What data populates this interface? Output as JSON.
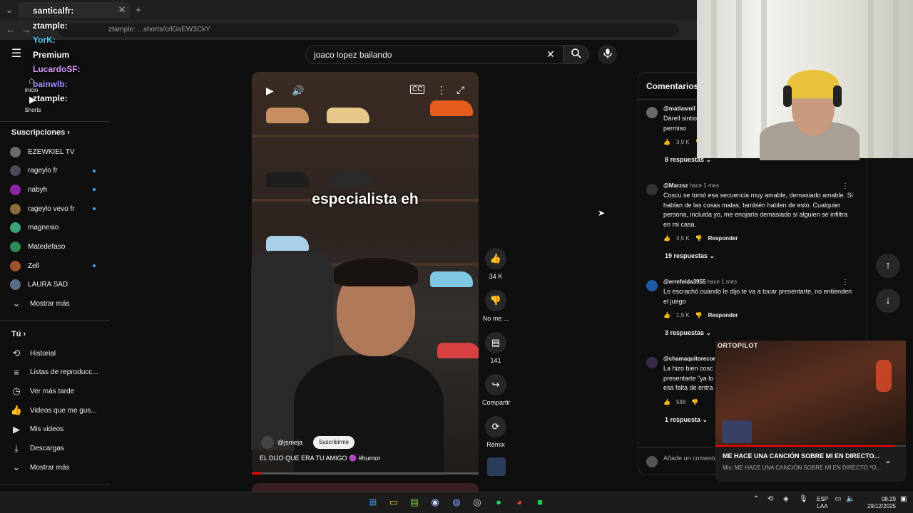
{
  "browser": {
    "tab_title": "santicalfr",
    "address": "ztample: ...shorts/crlGsEW3CkY"
  },
  "youtube": {
    "search_value": "joaco lopez bailando",
    "sidebar": {
      "main": [
        {
          "label": "Inicio",
          "icon": "home-icon"
        },
        {
          "label": "Shorts",
          "icon": "shorts-icon"
        }
      ],
      "subscriptions_title": "Suscripciones",
      "subscriptions": [
        {
          "label": "EZEWKIEL TV",
          "dot": false,
          "color": "#6b6b6b"
        },
        {
          "label": "rageylo fr",
          "dot": true,
          "color": "#4a4a5a"
        },
        {
          "label": "nabyh",
          "dot": true,
          "color": "#8e24aa"
        },
        {
          "label": "rageylo vevo fr",
          "dot": true,
          "color": "#8a6d3b"
        },
        {
          "label": "magnesio",
          "dot": false,
          "color": "#3aa57a"
        },
        {
          "label": "Matedefaso",
          "dot": false,
          "color": "#2e8b57"
        },
        {
          "label": "Zell",
          "dot": true,
          "color": "#a0522d"
        },
        {
          "label": "LAURA SAD",
          "dot": false,
          "color": "#5b6b8a"
        }
      ],
      "show_more": "Mostrar más",
      "you_title": "Tú",
      "you_items": [
        {
          "label": "Historial",
          "icon": "history-icon"
        },
        {
          "label": "Listas de reproducc...",
          "icon": "playlist-icon"
        },
        {
          "label": "Ver más tarde",
          "icon": "clock-icon"
        },
        {
          "label": "Videos que me gus...",
          "icon": "thumbs-up-icon"
        },
        {
          "label": "Mis videos",
          "icon": "my-videos-icon"
        },
        {
          "label": "Descargas",
          "icon": "download-icon"
        }
      ],
      "show_more_2": "Mostrar más"
    },
    "short": {
      "caption": "especialista eh",
      "channel": "@jsmeja",
      "subscribe": "Suscribirme",
      "title": "EL DIJO QUE ERA TU AMIGO 🟣 #humor",
      "progress": 0.04
    },
    "actions": {
      "like_count": "34 K",
      "dislike_label": "No me ...",
      "comments_count": "141",
      "share_label": "Compartir",
      "remix_label": "Remix"
    },
    "comments": {
      "title": "Comentarios",
      "items": [
        {
          "user": "@matiasmil",
          "time": "",
          "text": "Dárell sintio\npermiso",
          "likes": "3,9 K",
          "replies": "8 respuestas",
          "avatar": "#6a6a6a",
          "reply_label": ""
        },
        {
          "user": "@Marzsz",
          "time": "hace 1 mes",
          "text": "Coscu se tomó esa secuencia muy amable, demasiado amable. Si hablan de las cosas malas, también hablen de esto. Cualquier persona, incluida yo, me enojaría demasiado si alguien se infiltra en mi casa.",
          "likes": "4,5 K",
          "replies": "19 respuestas",
          "avatar": "#333333",
          "reply_label": "Responder"
        },
        {
          "user": "@errefelda3955",
          "time": "hace 1 mes",
          "text": "Lo escrachó cuando le dijo te va a tocar presentarte, no entienden el juego",
          "likes": "1,9 K",
          "replies": "3 respuestas",
          "avatar": "#1e5aa8",
          "reply_label": "Responder"
        },
        {
          "user": "@chamaquitorecor",
          "time": "",
          "text": "La hizo bien cosc\npresentarte \"ya lo\nesa falta de entra",
          "likes": "588",
          "replies": "1 respuesta",
          "avatar": "#3a2a4a",
          "reply_label": ""
        }
      ],
      "add_placeholder": "Añade un comentario"
    }
  },
  "stream_overlay": {
    "players": [
      {
        "name": "santicalfr:",
        "color": "#ffffff"
      },
      {
        "name": "ztample:",
        "color": "#ffffff"
      },
      {
        "name": "YorK:",
        "color": "#4dd2ff"
      },
      {
        "name": "Premium",
        "color": "#ffffff"
      },
      {
        "name": "LucardoSF:",
        "color": "#d89cff"
      },
      {
        "name": "bainwlb:",
        "color": "#a88cff"
      },
      {
        "name": "ztample:",
        "color": "#ffffff"
      }
    ],
    "pip": {
      "label": "ORTOPILOT",
      "title": "ME HACE UNA CANCIÓN SOBRE MI EN DIRECTO...",
      "subtitle": "Mix: ME HACE UNA CANCIÓN SOBRE MI EN DIRECTO *O...",
      "progress": 0.94
    }
  },
  "taskbar": {
    "lang": "ESP",
    "lang2": "LAA",
    "time": "08:29",
    "date": "29/12/2025"
  }
}
